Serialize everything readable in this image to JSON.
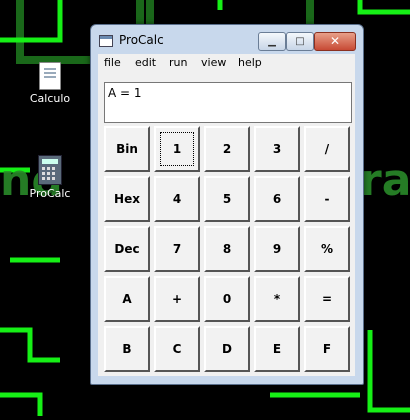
{
  "desktop": {
    "icons": [
      {
        "label": "Calculo"
      },
      {
        "label": "ProCalc"
      }
    ]
  },
  "window": {
    "title": "ProCalc",
    "controls": {
      "minimize": "▁",
      "maximize": "□",
      "close": "✕"
    }
  },
  "menu": [
    "file",
    "edit",
    "run",
    "view",
    "help"
  ],
  "display": {
    "text": "A = 1"
  },
  "keys": [
    [
      "Bin",
      "1",
      "2",
      "3",
      "/"
    ],
    [
      "Hex",
      "4",
      "5",
      "6",
      "-"
    ],
    [
      "Dec",
      "7",
      "8",
      "9",
      "%"
    ],
    [
      "A",
      "+",
      "0",
      "*",
      "="
    ],
    [
      "B",
      "C",
      "D",
      "E",
      "F"
    ]
  ],
  "colors": {
    "accent": "#00ff00",
    "window_frame": "#c8d8ec",
    "close": "#c74a35"
  }
}
